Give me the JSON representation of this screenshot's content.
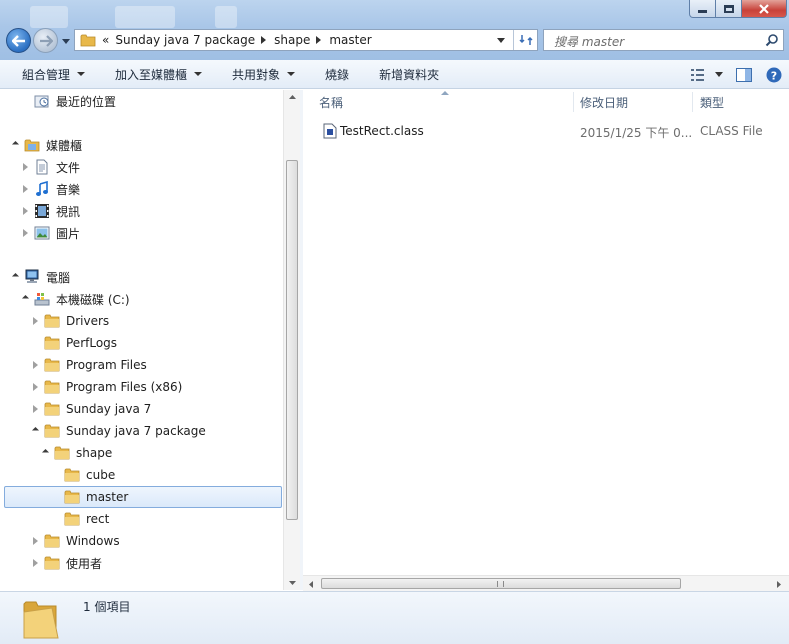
{
  "window": {
    "buttons": {
      "minimize": "minimize-icon",
      "maximize": "maximize-icon",
      "close": "close-icon"
    }
  },
  "address_bar": {
    "overflow": "«",
    "crumbs": [
      "Sunday java 7 package",
      "shape",
      "master"
    ]
  },
  "search": {
    "placeholder": "搜尋 master"
  },
  "command_bar": {
    "organize": "組合管理",
    "include_in_library": "加入至媒體櫃",
    "share_with": "共用對象",
    "burn": "燒錄",
    "new_folder": "新增資料夾"
  },
  "nav_tree": {
    "recent": "最近的位置",
    "libraries": "媒體櫃",
    "documents": "文件",
    "music": "音樂",
    "videos": "視訊",
    "pictures": "圖片",
    "computer": "電腦",
    "local_disk": "本機磁碟 (C:)",
    "drivers": "Drivers",
    "perflogs": "PerfLogs",
    "program_files": "Program Files",
    "program_files_x86": "Program Files (x86)",
    "sunday_java7": "Sunday java 7",
    "sunday_java7_package": "Sunday java 7 package",
    "shape": "shape",
    "cube": "cube",
    "master": "master",
    "rect": "rect",
    "windows": "Windows",
    "users": "使用者"
  },
  "file_list": {
    "columns": {
      "name": "名稱",
      "modified": "修改日期",
      "type": "類型"
    },
    "rows": [
      {
        "name": "TestRect.class",
        "modified": "2015/1/25 下午 0...",
        "type": "CLASS File"
      }
    ]
  },
  "details_pane": {
    "count": "1 個項目"
  },
  "colors": {
    "accent": "#3c7fd1",
    "selection": "#dbe9fa",
    "folder": "#e8b84a"
  }
}
